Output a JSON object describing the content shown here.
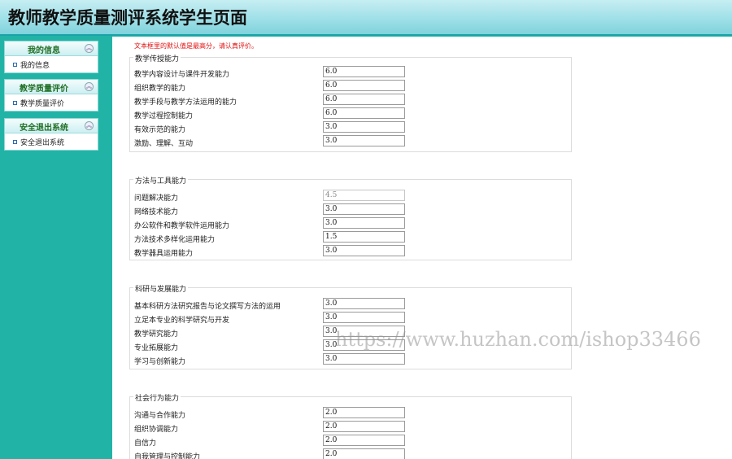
{
  "header": {
    "title": "教师教学质量测评系统学生页面"
  },
  "sidebar": {
    "groups": [
      {
        "title": "我的信息",
        "item": "我的信息"
      },
      {
        "title": "教学质量评价",
        "item": "教学质量评价"
      },
      {
        "title": "安全退出系统",
        "item": "安全退出系统"
      }
    ]
  },
  "main": {
    "notice": "文本框里的默认值是最高分，请认真评价。",
    "sections": [
      {
        "title": "教学传授能力",
        "rows": [
          {
            "label": "教学内容设计与课件开发能力",
            "value": "6.0"
          },
          {
            "label": "组织教学的能力",
            "value": "6.0"
          },
          {
            "label": "教学手段与教学方法运用的能力",
            "value": "6.0"
          },
          {
            "label": "教学过程控制能力",
            "value": "6.0"
          },
          {
            "label": "有效示范的能力",
            "value": "3.0"
          },
          {
            "label": "激励、理解、互动",
            "value": "3.0"
          }
        ]
      },
      {
        "title": "方法与工具能力",
        "rows": [
          {
            "label": "问题解决能力",
            "value": "4.5"
          },
          {
            "label": "网络技术能力",
            "value": "3.0"
          },
          {
            "label": "办公软件和教学软件运用能力",
            "value": "3.0"
          },
          {
            "label": "方法技术多样化运用能力",
            "value": "1.5"
          },
          {
            "label": "教学器具运用能力",
            "value": "3.0"
          }
        ]
      },
      {
        "title": "科研与发展能力",
        "rows": [
          {
            "label": "基本科研方法研究报告与论文撰写方法的运用",
            "value": "3.0"
          },
          {
            "label": "立足本专业的科学研究与开发",
            "value": "3.0"
          },
          {
            "label": "教学研究能力",
            "value": "3.0"
          },
          {
            "label": "专业拓展能力",
            "value": "3.0"
          },
          {
            "label": "学习与创新能力",
            "value": "3.0"
          }
        ]
      },
      {
        "title": "社会行为能力",
        "rows": [
          {
            "label": "沟通与合作能力",
            "value": "2.0"
          },
          {
            "label": "组织协调能力",
            "value": "2.0"
          },
          {
            "label": "自信力",
            "value": "2.0"
          },
          {
            "label": "自我管理与控制能力",
            "value": "2.0"
          }
        ]
      }
    ]
  },
  "watermark": "https://www.huzhan.com/ishop33466"
}
